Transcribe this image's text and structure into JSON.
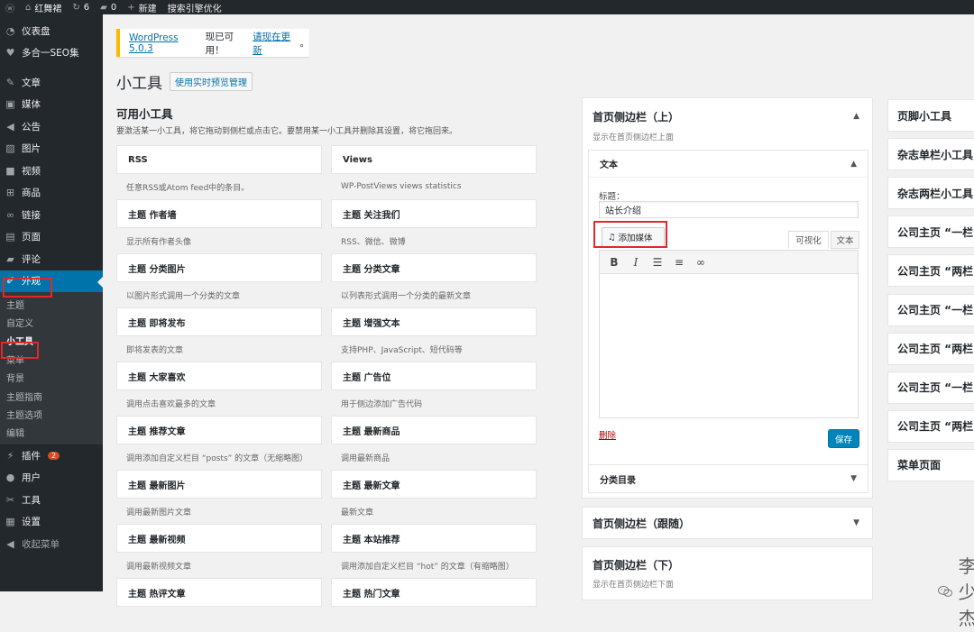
{
  "adminbar": {
    "site": "红舞裙",
    "updates": "6",
    "comments": "0",
    "new": "新建",
    "seo": "搜索引擎优化"
  },
  "menu": {
    "dashboard": "仪表盘",
    "seo": "多合一SEO集",
    "posts": "文章",
    "media": "媒体",
    "notice": "公告",
    "images": "图片",
    "video": "视频",
    "products": "商品",
    "links": "链接",
    "pages": "页面",
    "comments": "评论",
    "appearance": "外观",
    "sub": [
      "主题",
      "自定义",
      "小工具",
      "菜单",
      "背景",
      "主题指南",
      "主题选项",
      "编辑"
    ],
    "plugins": "插件",
    "plugins_badge": "2",
    "users": "用户",
    "tools": "工具",
    "settings": "设置",
    "collapse": "收起菜单"
  },
  "notice": {
    "version": "WordPress 5.0.3",
    "text": "现已可用！",
    "link": "请现在更新",
    "end": "。"
  },
  "page": {
    "title": "小工具",
    "preview_btn": "使用实时预览管理"
  },
  "available": {
    "title": "可用小工具",
    "desc": "要激活某一小工具，将它拖动到侧栏或点击它。要禁用某一小工具并删除其设置，将它拖回来。"
  },
  "widgets_left": [
    {
      "name": "RSS",
      "desc": "任意RSS或Atom feed中的条目。"
    },
    {
      "name": "主题  作者墙",
      "desc": "显示所有作者头像"
    },
    {
      "name": "主题  分类图片",
      "desc": "以图片形式调用一个分类的文章"
    },
    {
      "name": "主题  即将发布",
      "desc": "即将发表的文章"
    },
    {
      "name": "主题  大家喜欢",
      "desc": "调用点击喜欢最多的文章"
    },
    {
      "name": "主题  推荐文章",
      "desc": "调用添加自定义栏目 “posts” 的文章（无缩略图）"
    },
    {
      "name": "主题  最新图片",
      "desc": "调用最新图片文章"
    },
    {
      "name": "主题  最新视频",
      "desc": "调用最新视频文章"
    },
    {
      "name": "主题  热评文章",
      "desc": ""
    }
  ],
  "widgets_right": [
    {
      "name": "Views",
      "desc": "WP-PostViews views statistics"
    },
    {
      "name": "主题  关注我们",
      "desc": "RSS、微信、微博"
    },
    {
      "name": "主题  分类文章",
      "desc": "以列表形式调用一个分类的最新文章"
    },
    {
      "name": "主题  增强文本",
      "desc": "支持PHP、JavaScript、短代码等"
    },
    {
      "name": "主题  广告位",
      "desc": "用于侧边添加广告代码"
    },
    {
      "name": "主题  最新商品",
      "desc": "调用最新商品"
    },
    {
      "name": "主题  最新文章",
      "desc": "最新文章"
    },
    {
      "name": "主题  本站推荐",
      "desc": "调用添加自定义栏目 “hot” 的文章（有缩略图）"
    },
    {
      "name": "主题  热门文章",
      "desc": ""
    }
  ],
  "sidebar_top": {
    "title": "首页侧边栏（上）",
    "desc": "显示在首页侧边栏上面"
  },
  "text_widget": {
    "title": "文本",
    "label": "标题：",
    "value": "站长介绍",
    "add_media": "添加媒体",
    "tab_visual": "可视化",
    "tab_text": "文本",
    "delete": "删除",
    "save": "保存"
  },
  "category_widget": "分类目录",
  "sidebar_follow": {
    "title": "首页侧边栏（跟随）"
  },
  "sidebar_bottom": {
    "title": "首页侧边栏（下）",
    "desc": "显示在首页侧边栏下面"
  },
  "right_areas": [
    "页脚小工具",
    "杂志单栏小工具",
    "杂志两栏小工具",
    "公司主页 “一栏",
    "公司主页 “两栏",
    "公司主页 “一栏",
    "公司主页 “两栏",
    "公司主页 “一栏",
    "公司主页 “两栏",
    "菜单页面"
  ],
  "watermark": "李少杰"
}
